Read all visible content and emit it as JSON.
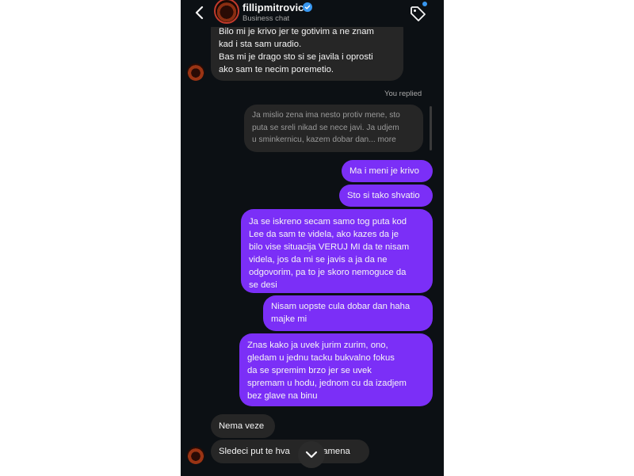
{
  "header": {
    "username": "fillipmitrovic",
    "subtitle": "Business chat"
  },
  "messages": {
    "top_incoming": "Bilo mi je krivo jer te gotivim a ne znam\nkad i sta sam uradio.\nBas mi je drago sto si se javila i oprosti\nako sam te necim poremetio.",
    "replied_label": "You replied",
    "quoted_reply": "Ja mislio zena ima nesto protiv mene, sto\nputa se sreli nikad se nece javi. Ja udjem\nu sminkernicu, kazem dobar dan... more",
    "out1": "Ma i meni je krivo",
    "out2": "Sto si tako shvatio",
    "out3": "Ja se iskreno secam samo tog puta kod\nLee da sam te videla, ako kazes da je\nbilo vise situacija VERUJ MI da te nisam\nvidela, jos da mi se javis a ja da ne\nodgovorim, pa to je skoro nemoguce da\nse desi",
    "out4": "Nisam uopste cula dobar dan haha\nmajke mi",
    "out5": "Znas kako ja uvek jurim zurim, ono,\ngledam u jednu tacku bukvalno fokus\nda se spremim brzo jer se uvek\nspremam u hodu, jednom cu da izadjem\nbez glave na binu",
    "in1": "Nema veze",
    "in2": "Sledeci put te hva        ta ramena"
  },
  "colors": {
    "background": "#0c1014",
    "incoming_bubble": "#262626",
    "outgoing_bubble": "#7b2ff7",
    "verified_badge": "#3897f0"
  },
  "icons": [
    "back-arrow-icon",
    "verified-badge-icon",
    "tag-icon",
    "chevron-down-icon"
  ]
}
